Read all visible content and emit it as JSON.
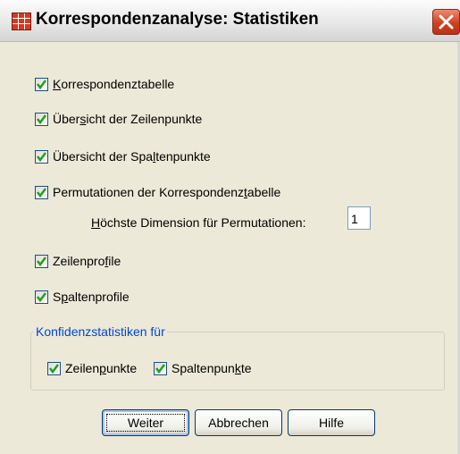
{
  "window": {
    "title": "Korrespondenzanalyse: Statistiken"
  },
  "checkboxes": [
    {
      "pre": "",
      "ul": "K",
      "post": "orrespondenztabelle",
      "checked": true
    },
    {
      "pre": "Über",
      "ul": "s",
      "post": "icht der Zeilenpunkte",
      "checked": true
    },
    {
      "pre": "Übersicht der Spa",
      "ul": "l",
      "post": "tenpunkte",
      "checked": true
    },
    {
      "pre": "Permutationen der Korrespondenz",
      "ul": "t",
      "post": "abelle",
      "checked": true
    },
    {
      "pre": "Zeilenpro",
      "ul": "f",
      "post": "ile",
      "checked": true
    },
    {
      "pre": "S",
      "ul": "p",
      "post": "altenprofile",
      "checked": true
    }
  ],
  "permutations": {
    "pre": "",
    "ul": "H",
    "post": "öchste Dimension für Permutationen:",
    "value": "1"
  },
  "confidence": {
    "title": "Konfidenzstatistiken für",
    "items": [
      {
        "pre": "Zeilen",
        "ul": "p",
        "post": "unkte",
        "checked": true
      },
      {
        "pre": "Spaltenpun",
        "ul": "k",
        "post": "te",
        "checked": true
      }
    ]
  },
  "buttons": {
    "continue": "Weiter",
    "cancel": "Abbrechen",
    "help": "Hilfe"
  },
  "colors": {
    "check": "#21a121",
    "group_title": "#0046d5",
    "dialog_bg": "#ece9d8"
  },
  "icons": {
    "app": "spss-table-icon",
    "close": "close-icon"
  }
}
